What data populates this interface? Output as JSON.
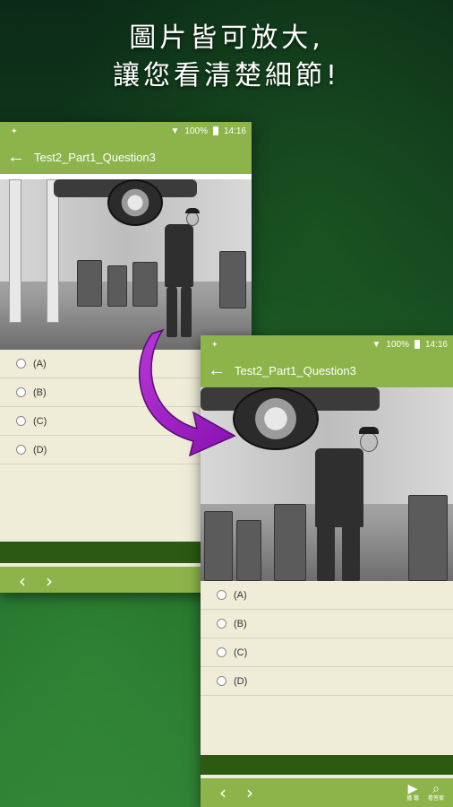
{
  "promo": {
    "line1": "圖片皆可放大,",
    "line2": "讓您看清楚細節!"
  },
  "status_bar": {
    "battery": "100%",
    "time": "14:16"
  },
  "app_bar": {
    "title": "Test2_Part1_Question3",
    "back_icon": "back-arrow-icon"
  },
  "options": [
    "(A)",
    "(B)",
    "(C)",
    "(D)"
  ],
  "bottom_nav": {
    "prev_icon": "chevron-left-icon",
    "next_icon": "chevron-right-icon",
    "play_label": "播 聽",
    "zoom_label": "看答案"
  },
  "colors": {
    "app_bar": "#8db44a",
    "bottom_strip": "#2c5a12",
    "content_bg": "#efedd8",
    "arrow": "#a020c0"
  }
}
